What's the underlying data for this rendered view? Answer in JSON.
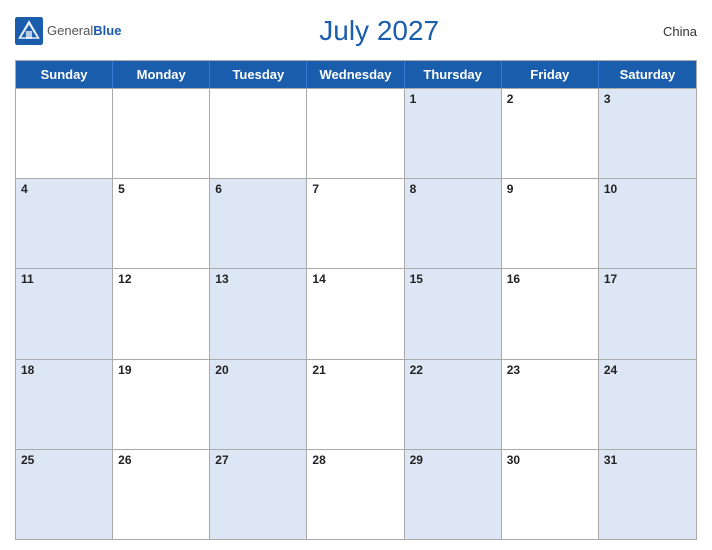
{
  "header": {
    "logo_general": "General",
    "logo_blue": "Blue",
    "title": "July 2027",
    "country": "China"
  },
  "days_of_week": [
    "Sunday",
    "Monday",
    "Tuesday",
    "Wednesday",
    "Thursday",
    "Friday",
    "Saturday"
  ],
  "weeks": [
    [
      {
        "date": "",
        "shaded": false
      },
      {
        "date": "",
        "shaded": false
      },
      {
        "date": "",
        "shaded": false
      },
      {
        "date": "",
        "shaded": false
      },
      {
        "date": "1",
        "shaded": true
      },
      {
        "date": "2",
        "shaded": false
      },
      {
        "date": "3",
        "shaded": true
      }
    ],
    [
      {
        "date": "4",
        "shaded": true
      },
      {
        "date": "5",
        "shaded": false
      },
      {
        "date": "6",
        "shaded": true
      },
      {
        "date": "7",
        "shaded": false
      },
      {
        "date": "8",
        "shaded": true
      },
      {
        "date": "9",
        "shaded": false
      },
      {
        "date": "10",
        "shaded": true
      }
    ],
    [
      {
        "date": "11",
        "shaded": true
      },
      {
        "date": "12",
        "shaded": false
      },
      {
        "date": "13",
        "shaded": true
      },
      {
        "date": "14",
        "shaded": false
      },
      {
        "date": "15",
        "shaded": true
      },
      {
        "date": "16",
        "shaded": false
      },
      {
        "date": "17",
        "shaded": true
      }
    ],
    [
      {
        "date": "18",
        "shaded": true
      },
      {
        "date": "19",
        "shaded": false
      },
      {
        "date": "20",
        "shaded": true
      },
      {
        "date": "21",
        "shaded": false
      },
      {
        "date": "22",
        "shaded": true
      },
      {
        "date": "23",
        "shaded": false
      },
      {
        "date": "24",
        "shaded": true
      }
    ],
    [
      {
        "date": "25",
        "shaded": true
      },
      {
        "date": "26",
        "shaded": false
      },
      {
        "date": "27",
        "shaded": true
      },
      {
        "date": "28",
        "shaded": false
      },
      {
        "date": "29",
        "shaded": true
      },
      {
        "date": "30",
        "shaded": false
      },
      {
        "date": "31",
        "shaded": true
      }
    ]
  ],
  "colors": {
    "header_bg": "#1a5dad",
    "shaded_cell": "#dce6f5",
    "white_cell": "#ffffff"
  }
}
